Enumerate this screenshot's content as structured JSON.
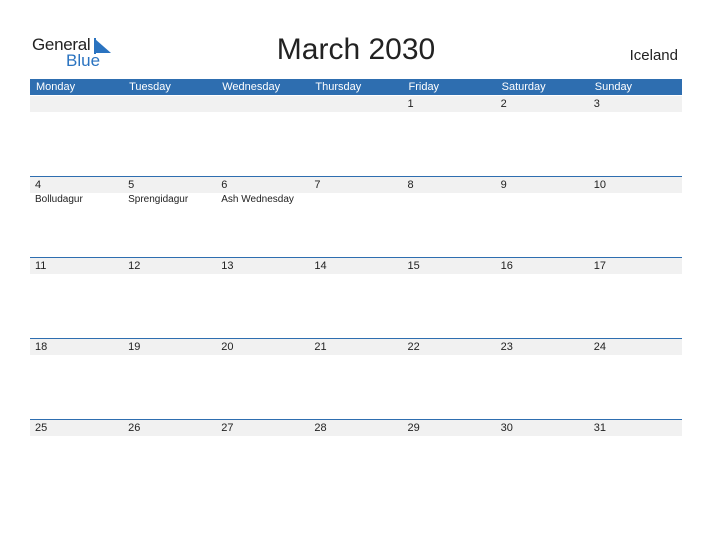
{
  "logo": {
    "word1": "General",
    "word2": "Blue"
  },
  "title": "March 2030",
  "country": "Iceland",
  "weekdays": [
    "Monday",
    "Tuesday",
    "Wednesday",
    "Thursday",
    "Friday",
    "Saturday",
    "Sunday"
  ],
  "weeks": [
    {
      "days": [
        "",
        "",
        "",
        "",
        "1",
        "2",
        "3"
      ],
      "events": [
        "",
        "",
        "",
        "",
        "",
        "",
        ""
      ]
    },
    {
      "days": [
        "4",
        "5",
        "6",
        "7",
        "8",
        "9",
        "10"
      ],
      "events": [
        "Bolludagur",
        "Sprengidagur",
        "Ash Wednesday",
        "",
        "",
        "",
        ""
      ]
    },
    {
      "days": [
        "11",
        "12",
        "13",
        "14",
        "15",
        "16",
        "17"
      ],
      "events": [
        "",
        "",
        "",
        "",
        "",
        "",
        ""
      ]
    },
    {
      "days": [
        "18",
        "19",
        "20",
        "21",
        "22",
        "23",
        "24"
      ],
      "events": [
        "",
        "",
        "",
        "",
        "",
        "",
        ""
      ]
    },
    {
      "days": [
        "25",
        "26",
        "27",
        "28",
        "29",
        "30",
        "31"
      ],
      "events": [
        "",
        "",
        "",
        "",
        "",
        "",
        ""
      ]
    }
  ],
  "colors": {
    "accent": "#2e6eb0",
    "row_bg": "#f1f1f1",
    "logo_blue": "#2a73c0"
  }
}
